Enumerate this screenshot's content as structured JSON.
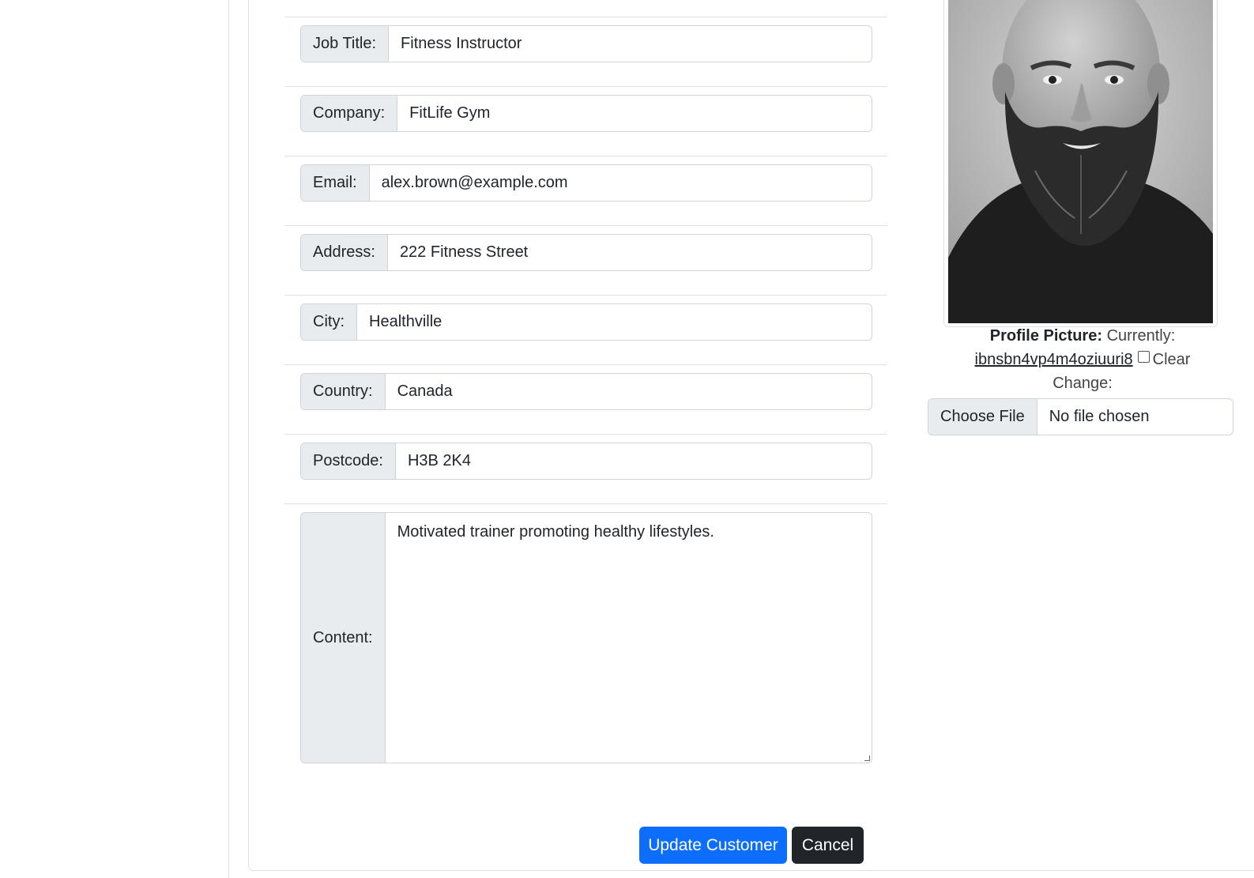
{
  "form": {
    "fields": [
      {
        "label": "Job Title:",
        "value": "Fitness Instructor"
      },
      {
        "label": "Company:",
        "value": "FitLife Gym"
      },
      {
        "label": "Email:",
        "value": "alex.brown@example.com"
      },
      {
        "label": "Address:",
        "value": "222 Fitness Street"
      },
      {
        "label": "City:",
        "value": "Healthville"
      },
      {
        "label": "Country:",
        "value": "Canada"
      },
      {
        "label": "Postcode:",
        "value": "H3B 2K4"
      }
    ],
    "content": {
      "label": "Content:",
      "value": "Motivated trainer promoting healthy lifestyles."
    }
  },
  "profile": {
    "label": "Profile Picture:",
    "currently_text": "Currently:",
    "current_file": "ibnsbn4vp4m4oziuuri8",
    "clear_label": "Clear",
    "clear_checked": false,
    "change_label": "Change:",
    "choose_file_label": "Choose File",
    "file_status": "No file chosen"
  },
  "actions": {
    "update_label": "Update Customer",
    "cancel_label": "Cancel"
  },
  "colors": {
    "primary": "#0d6efd",
    "dark": "#212529",
    "addon_bg": "#e9ecef",
    "border": "#ced4da"
  }
}
